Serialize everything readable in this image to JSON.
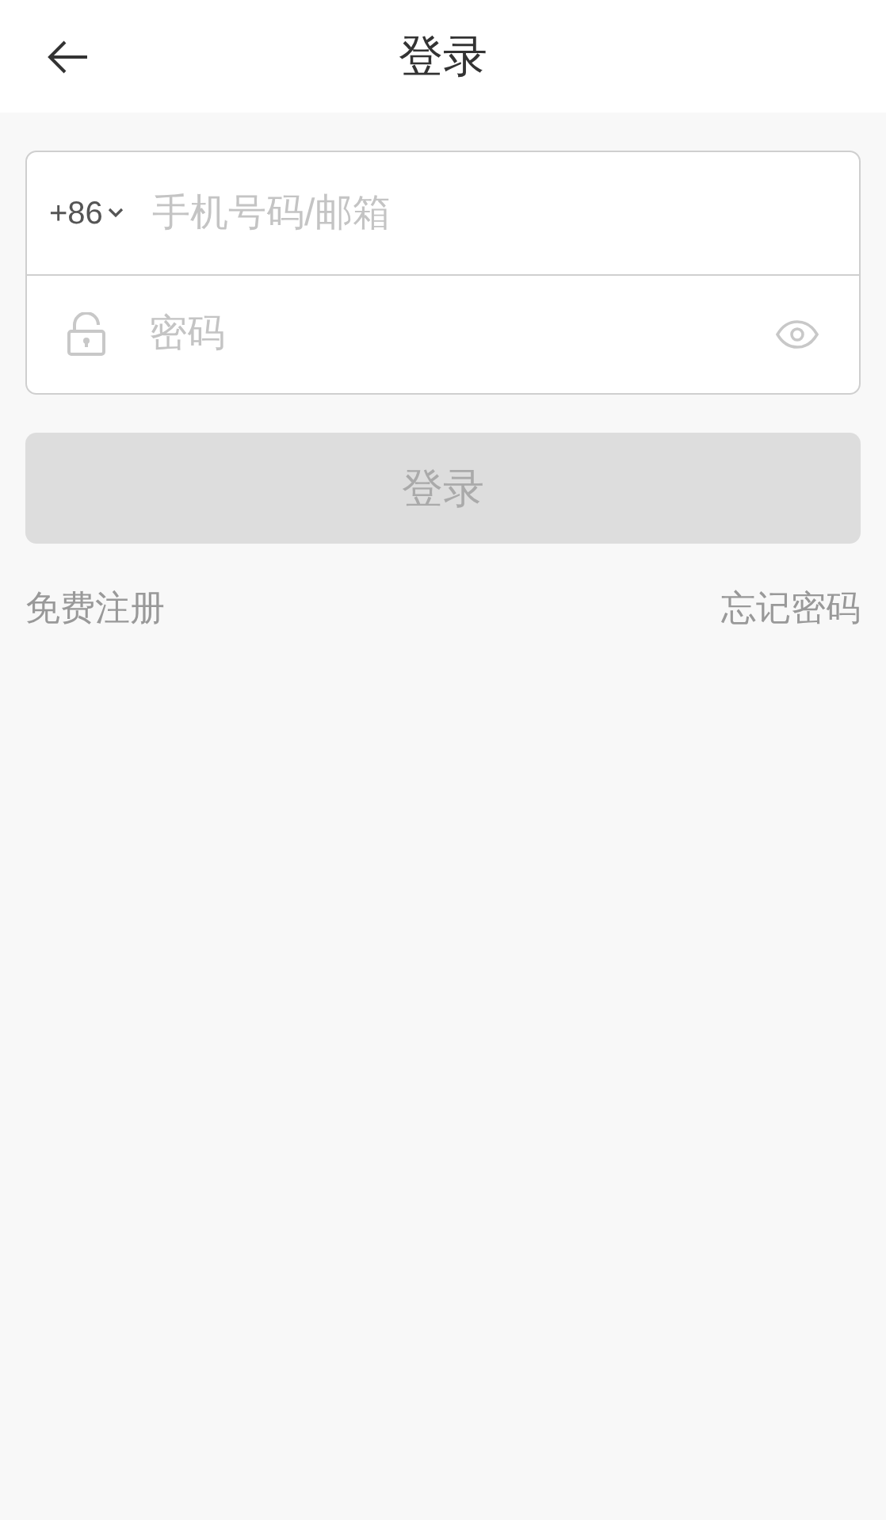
{
  "header": {
    "title": "登录"
  },
  "form": {
    "country_code": "+86",
    "account": {
      "placeholder": "手机号码/邮箱"
    },
    "password": {
      "placeholder": "密码"
    }
  },
  "login_button": {
    "label": "登录",
    "disabled": true
  },
  "links": [
    {
      "label": "免费注册"
    },
    {
      "label": "忘记密码"
    }
  ]
}
